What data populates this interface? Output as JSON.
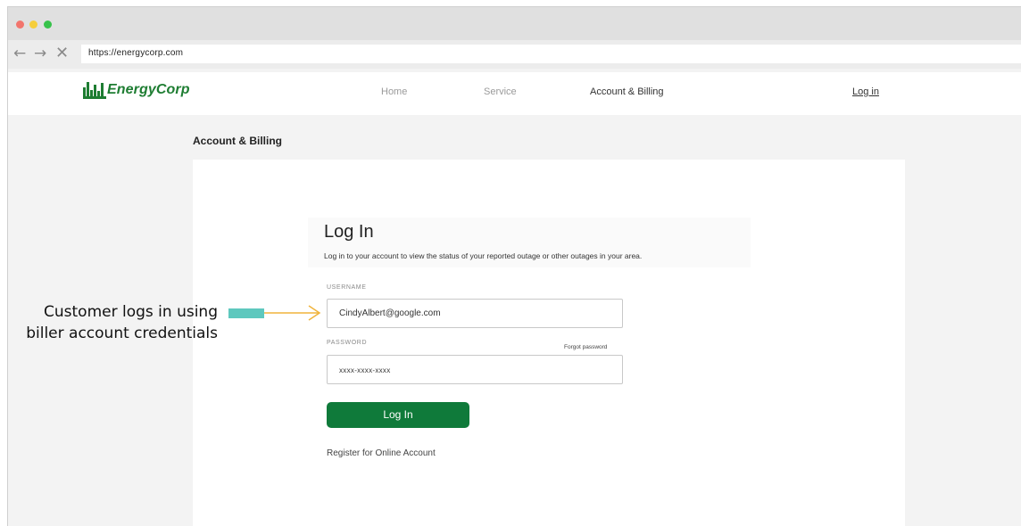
{
  "browser": {
    "url": "https://energycorp.com",
    "back_glyph": "←",
    "forward_glyph": "→",
    "stop_glyph": "✕"
  },
  "site": {
    "logo_text": "EnergyCorp",
    "nav": {
      "home": "Home",
      "service": "Service",
      "account": "Account & Billing",
      "login": "Log in"
    }
  },
  "page": {
    "heading": "Account & Billing"
  },
  "login": {
    "title": "Log In",
    "subtitle": "Log in to your account to view the status of your reported outage or other outages in your area.",
    "username_label": "USERNAME",
    "username_value": "CindyAlbert@google.com",
    "password_label": "PASSWORD",
    "forgot_password": "Forgot password",
    "password_value": "xxxx-xxxx-xxxx",
    "button_label": "Log In",
    "register_link": "Register for Online Account"
  },
  "annotation": {
    "text": "Customer logs in using biller account credentials"
  },
  "colors": {
    "brand_green": "#1e7d32",
    "button_green": "#0f7a3a",
    "callout_teal": "#5ec8be",
    "arrow_orange": "#f0b43c"
  },
  "icons": {
    "logo": "city-skyline-icon",
    "arrow": "right-arrow-icon"
  }
}
